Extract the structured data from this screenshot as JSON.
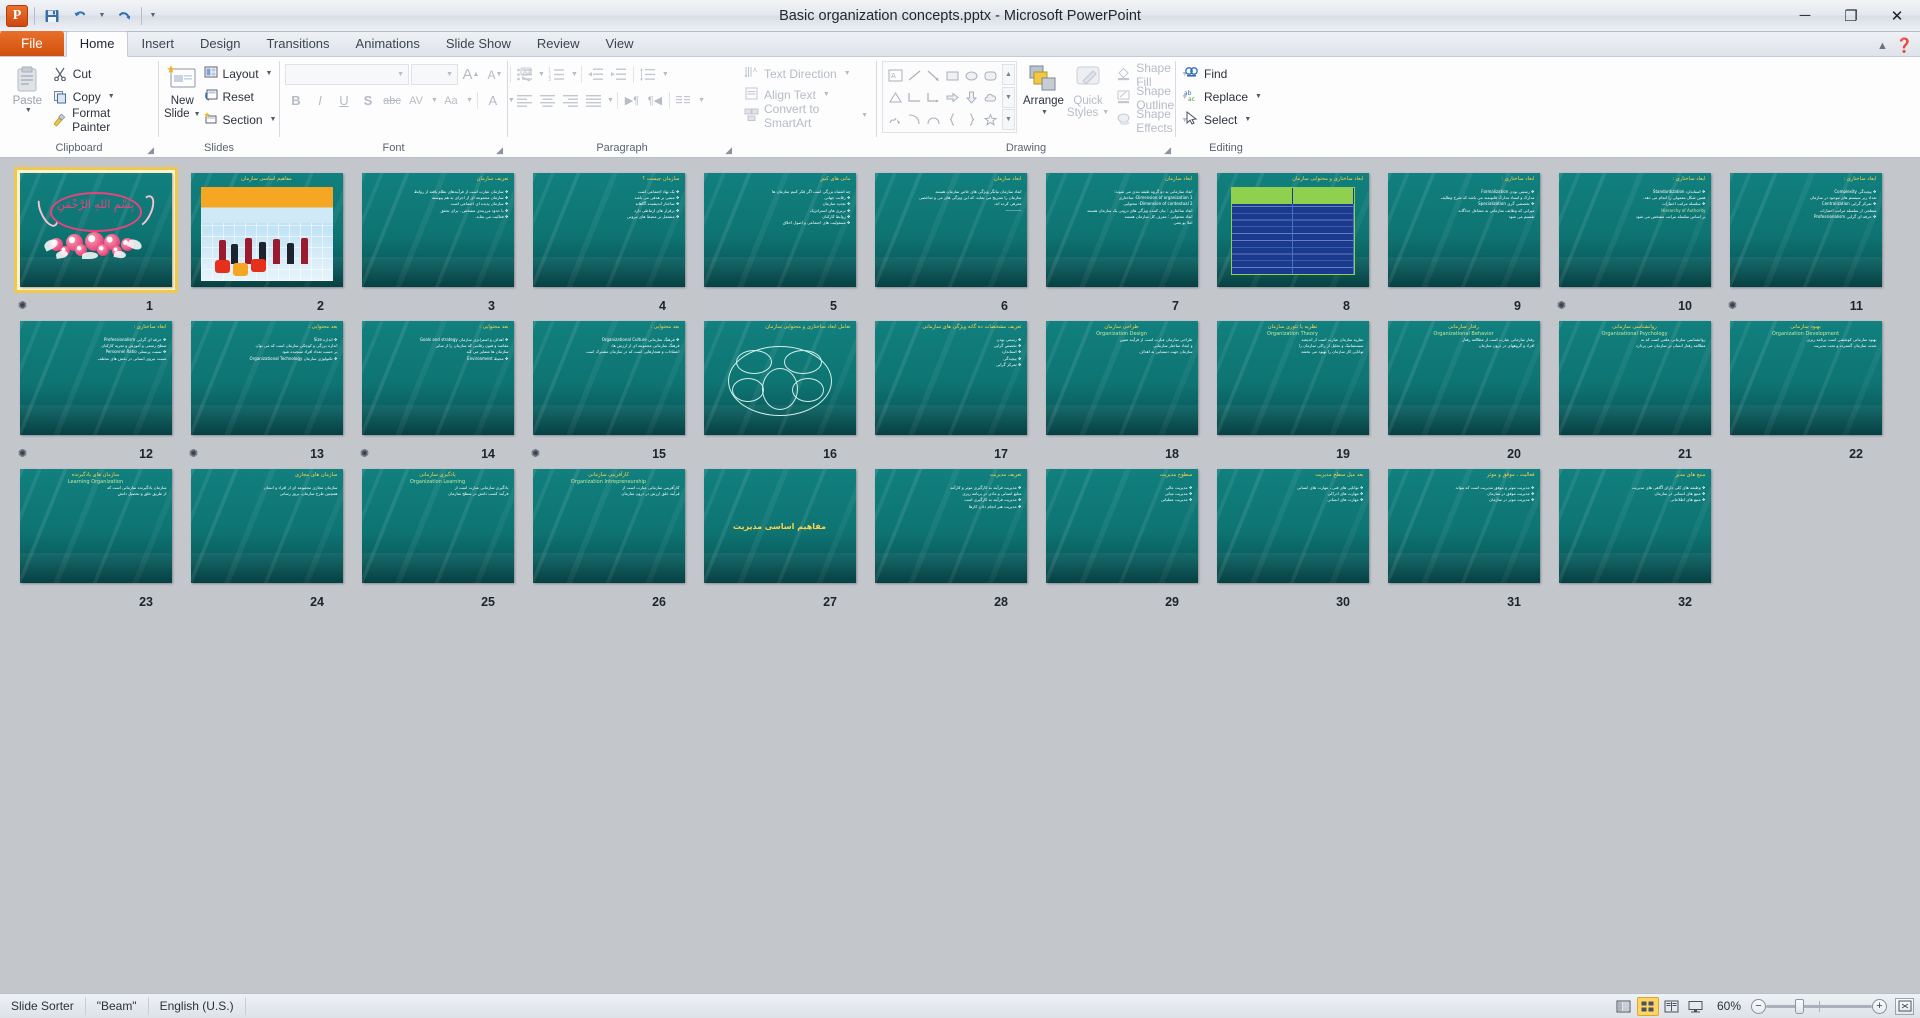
{
  "window": {
    "title": "Basic organization concepts.pptx  -  Microsoft PowerPoint",
    "minimize": "─",
    "restore": "❐",
    "close": "✕"
  },
  "quick_access": {
    "app_logo": "P",
    "save": "save-icon",
    "undo": "undo-icon",
    "redo": "redo-icon",
    "customize": "customize-icon"
  },
  "tabs": [
    {
      "label": "File",
      "type": "file"
    },
    {
      "label": "Home",
      "type": "active"
    },
    {
      "label": "Insert",
      "type": "normal"
    },
    {
      "label": "Design",
      "type": "normal"
    },
    {
      "label": "Transitions",
      "type": "normal"
    },
    {
      "label": "Animations",
      "type": "normal"
    },
    {
      "label": "Slide Show",
      "type": "normal"
    },
    {
      "label": "Review",
      "type": "normal"
    },
    {
      "label": "View",
      "type": "normal"
    }
  ],
  "ribbon": {
    "clipboard": {
      "label": "Clipboard",
      "paste": "Paste",
      "cut": "Cut",
      "copy": "Copy",
      "format_painter": "Format Painter"
    },
    "slides": {
      "label": "Slides",
      "new_slide": "New\nSlide",
      "new_slide_line1": "New",
      "new_slide_line2": "Slide",
      "layout": "Layout",
      "reset": "Reset",
      "section": "Section"
    },
    "font": {
      "label": "Font",
      "font_name": "",
      "font_size": "",
      "grow_font": "A",
      "shrink_font": "A",
      "clear_formatting": "clear-formatting-icon",
      "bold": "B",
      "italic": "I",
      "underline": "U",
      "shadow": "S",
      "strikethrough": "abc",
      "character_spacing": "AV",
      "change_case": "Aa",
      "font_color": "A"
    },
    "paragraph": {
      "label": "Paragraph",
      "text_direction": "Text Direction",
      "align_text": "Align Text",
      "convert_to_smartart": "Convert to SmartArt"
    },
    "drawing": {
      "label": "Drawing",
      "arrange": "Arrange",
      "quick_styles_line1": "Quick",
      "quick_styles_line2": "Styles",
      "shape_fill": "Shape Fill",
      "shape_outline": "Shape Outline",
      "shape_effects": "Shape Effects"
    },
    "editing": {
      "label": "Editing",
      "find": "Find",
      "replace": "Replace",
      "select": "Select"
    }
  },
  "status_bar": {
    "view_name": "Slide Sorter",
    "theme": "\"Beam\"",
    "language": "English (U.S.)",
    "zoom_level": "60%",
    "zoom_out": "−",
    "zoom_in": "+",
    "view_buttons": [
      {
        "name": "normal-view",
        "active": false
      },
      {
        "name": "slide-sorter-view",
        "active": true
      },
      {
        "name": "reading-view",
        "active": false
      },
      {
        "name": "slide-show-view",
        "active": false
      }
    ],
    "fit_to_window": "fit-slide-to-window-icon"
  },
  "slides": [
    {
      "number": "1",
      "selected": true,
      "kind": "bismillah",
      "has_transition": true,
      "title": "",
      "body": []
    },
    {
      "number": "2",
      "selected": false,
      "kind": "picture",
      "has_transition": false,
      "title": "مفاهیم اساسی سازمان",
      "body": []
    },
    {
      "number": "3",
      "selected": false,
      "kind": "text",
      "has_transition": false,
      "title": "تعریف سازمان",
      "body": [
        "❖ سازمان عبارت است از فرآیندهای نظام یافته از روابط",
        "❖ سازمان مجموعه ای از اجزای به هم پیوسته",
        "❖ سازمان پدیده ای اجتماعی است",
        "❖ با حدود مرزبندی مشخص ، برای تحقق",
        "❖ فعالیت می نماید."
      ]
    },
    {
      "number": "4",
      "selected": false,
      "kind": "text",
      "has_transition": false,
      "title": "سازمان چیست ؟",
      "body": [
        "❖ یک نهاد اجتماعی است",
        "❖ مبتنی بر هدفی می باشد",
        "❖ ساختار اندیشیده آگاهانه",
        "❖ برقرار های ارتباطی دارد",
        "❖ مشتمل بر محیط های بیرونی"
      ]
    },
    {
      "number": "5",
      "selected": false,
      "kind": "text",
      "has_transition": false,
      "title": "مانی های کبیر",
      "body": [
        "چه اشتباه بزرگی است اگر فکر کنیم سازمان ها",
        "❖ رقابت جهانی",
        "❖ تجدید سازمان",
        "❖ برتری های استراتژیک",
        "❖ روابط کارکنان",
        "❖ مسئولیت های اجتماعی و اصول اخلاق"
      ]
    },
    {
      "number": "6",
      "selected": false,
      "kind": "text",
      "has_transition": false,
      "title": "ابعاد سازمان",
      "body": [
        "ابعاد سازمان بیانگر ویژگی های خاص سازمان هستند",
        "سازمان را تشریح می نماید، که این ویژگی های می و شاخصی",
        "معرفی کرده اند.",
        "————"
      ]
    },
    {
      "number": "7",
      "selected": false,
      "kind": "text",
      "has_transition": false,
      "title": "ابعاد سازمان",
      "body": [
        "ابعاد سازمانی به دو گروه طبقه بندی می شوند:",
        "Dimension of organization    1- ساختاری",
        "Dimension of contextual    2- محتوایی",
        "ابعاد ساختاری : بیان کننده ویژگی های درونی یک سازمان هستند",
        "ابعاد محتوایی : معرف کل سازمان هستند",
        "املا پو یعنی"
      ]
    },
    {
      "number": "8",
      "selected": false,
      "kind": "table",
      "has_transition": false,
      "title": "ابعاد ساختاری و محتوایی سازمان",
      "body": []
    },
    {
      "number": "9",
      "selected": false,
      "kind": "text",
      "has_transition": false,
      "title": "ابعاد ساختاری :",
      "body": [
        "❖ رسمی بودن Formalization",
        "مدارک و اسناد مدارک قانونمند می باشد که شرح وظایف",
        "❖ تخصصی گری Specialization",
        "میزانی که وظایف سازمانی به مشاغل جداگانه",
        "تقسیم می شود"
      ]
    },
    {
      "number": "10",
      "selected": false,
      "kind": "text",
      "has_transition": true,
      "title": "ابعاد ساختاری :",
      "body": [
        "❖ استاندارد Standardization",
        "همین شکل معمولی را انجام می دهد،",
        "❖ سلسله مراتب اختیارات",
        "Hierarchy of Authority",
        "بر اساس سلسله مراتب مشخص می شود"
      ]
    },
    {
      "number": "11",
      "selected": false,
      "kind": "text",
      "has_transition": true,
      "title": "ابعاد ساختاری :",
      "body": [
        "❖ پیچیدگی Complexity",
        "تعداد زیر سیستم های موجود در سازمان",
        "❖ تمرکز گرایی Centralization",
        "سطحی از سلسله مراتب اختیارات",
        "❖ حرفه ای گرایی Professionalism"
      ]
    },
    {
      "number": "12",
      "selected": false,
      "kind": "text",
      "has_transition": true,
      "title": "ابعاد ساختاری :",
      "body": [
        "❖ حرفه ای گرایی Professionalism",
        "سطح رسمی و آموزش و تجربه کارکنان",
        "❖ نسبت پرسنلی Personnel Ratio",
        "نسبت نیروی انسانی در بخش های مختلف"
      ]
    },
    {
      "number": "13",
      "selected": false,
      "kind": "text",
      "has_transition": true,
      "title": "بعد محتوایی :",
      "body": [
        "❖ اندازه Size",
        "اندازه بزرگی و کوچکی سازمان است که می توان",
        "بر حسب تعداد افراد سنجیده شود",
        "❖ تکنولوژی سازمان Organizational Technology"
      ]
    },
    {
      "number": "14",
      "selected": false,
      "kind": "text",
      "has_transition": true,
      "title": "بعد محتوایی :",
      "body": [
        "❖ اهداف و استراتژی سازمان Goals and strategy",
        "مقاصد و فنون رقابتی که سازمان را از سایر",
        "سازمان ها متمایز می کند",
        "❖ محیط Environment"
      ]
    },
    {
      "number": "15",
      "selected": false,
      "kind": "text",
      "has_transition": true,
      "title": "بعد محتوایی :",
      "body": [
        "❖ فرهنگ سازمانی Organizational Culture",
        "فرهنگ سازمانی مجموعه ای از ارزش ها،",
        "اعتقادات و هنجارهایی است که در سازمان مشترک است"
      ]
    },
    {
      "number": "16",
      "selected": false,
      "kind": "venn",
      "has_transition": false,
      "title": "تعامل ابعاد ساختاری و محتوایی سازمان",
      "body": []
    },
    {
      "number": "17",
      "selected": false,
      "kind": "text",
      "has_transition": false,
      "title": "تعریف مشخصات ده گانه ویژگی های سازمانی",
      "body": [
        "❖ رسمی بودن",
        "❖ تخصص گرایی",
        "❖ استاندارد",
        "❖ پیچیدگی",
        "❖ تمرکز گرایی"
      ]
    },
    {
      "number": "18",
      "selected": false,
      "kind": "text",
      "has_transition": false,
      "title": "طراحی سازمان",
      "title_en": "Organization Design",
      "body": [
        "طراحی سازمان عبارت است از فرآیند تعیین",
        "و ایجاد ساختار سازمانی",
        "سازمان جهت دستیابی به اهداف"
      ]
    },
    {
      "number": "19",
      "selected": false,
      "kind": "text",
      "has_transition": false,
      "title": "نظریه یا تئوری سازمان",
      "title_en": "Organization Theory",
      "body": [
        "نظریه سازمان عبارت است از اندیشه",
        "سیستماتیک و تحلیل از راکی سازمان را",
        "توانایی کار سازمان را بهبود می بخشد"
      ]
    },
    {
      "number": "20",
      "selected": false,
      "kind": "text",
      "has_transition": false,
      "title": "رفتار سازمانی",
      "title_en": "Organizational Behavior",
      "body": [
        "رفتار سازمانی عبارت است از مطالعه رفتار",
        "افراد و گروههای در درون سازمان"
      ]
    },
    {
      "number": "21",
      "selected": false,
      "kind": "text",
      "has_transition": false,
      "title": "روانشناسی سازمانی",
      "title_en": "Organizational Psychology",
      "body": [
        "روانشناسی سازمانی علمی است که به",
        "مطالعه رفتار انسان در سازمان می پردازد"
      ]
    },
    {
      "number": "22",
      "selected": false,
      "kind": "text",
      "has_transition": false,
      "title": "بهبود سازمانی",
      "title_en": "Organization Development",
      "body": [
        "بهبود سازمانی کوششی است برنامه ریزی",
        "شده، سازمان گسترده و تحت مدیریت"
      ]
    },
    {
      "number": "23",
      "selected": false,
      "kind": "text",
      "has_transition": false,
      "title": "سازمان های یادگیرنده",
      "title_en": "Learning Organization",
      "body": [
        "سازمان یادگیرنده سازمانی است که",
        "از طریق خلق و تحصیل دانش"
      ]
    },
    {
      "number": "24",
      "selected": false,
      "kind": "text",
      "has_transition": false,
      "title": "سازمان های مجازی",
      "body": [
        "سازمان مجازی مجموعه ای از افراد و انسان",
        "همچنین طرح سازمان، بروز رسانی"
      ]
    },
    {
      "number": "25",
      "selected": false,
      "kind": "text",
      "has_transition": false,
      "title": "یادگیری سازمانی",
      "title_en": "Organization Learning",
      "body": [
        "یادگیری سازمانی عبارت است از",
        "فرآیند کسب دانش در سطح سازمان"
      ]
    },
    {
      "number": "26",
      "selected": false,
      "kind": "text",
      "has_transition": false,
      "title": "کارآفرینی سازمانی",
      "title_en": "Organization Intrepreneurship",
      "body": [
        "کارآفرینی سازمانی عبارت است از",
        "فرآیند خلق ارزش در درون سازمان"
      ]
    },
    {
      "number": "27",
      "selected": false,
      "kind": "big",
      "has_transition": false,
      "title": "مفاهیم اساسی مدیریت",
      "body": []
    },
    {
      "number": "28",
      "selected": false,
      "kind": "text",
      "has_transition": false,
      "title": "تعریف مدیریت",
      "body": [
        "❖ مدیریت فرآیند به کارگیری موثر و کارآمد",
        "منابع انسانی و مادی در برنامه ریزی",
        "❖ مدیریت فرآیند به کارگیری است",
        "❖ مدیریت هنر انجام دادن کارها"
      ]
    },
    {
      "number": "29",
      "selected": false,
      "kind": "text",
      "has_transition": false,
      "title": "سطوح مدیریت",
      "body": [
        "❖ مدیریت عالی",
        "❖ مدیریت میانی",
        "❖ مدیریت عملیاتی"
      ]
    },
    {
      "number": "30",
      "selected": false,
      "kind": "text",
      "has_transition": false,
      "title": "بعد میل سطح مدیریت",
      "body": [
        "❖ توانایی های فنی ، مهارت های انسانی",
        "❖ مهارت های ادراکی",
        "❖ مهارت های انسانی"
      ]
    },
    {
      "number": "31",
      "selected": false,
      "kind": "text",
      "has_transition": false,
      "title": "فعالیت ، موفق و موثر",
      "body": [
        "❖ مدیریت موثر و موفق مدیریت است که بتواند",
        "❖ مدیریت موفق در سازمان",
        "❖ مدیریت موثر در سازمان"
      ]
    },
    {
      "number": "32",
      "selected": false,
      "kind": "text",
      "has_transition": false,
      "title": "منبع های مدیر",
      "body": [
        "❖ وظیفه های کلی دارای آگاهی های مدیریت",
        "❖ منبع های انسانی در سازمان",
        "❖ منبع های اطلاعاتی"
      ]
    }
  ]
}
